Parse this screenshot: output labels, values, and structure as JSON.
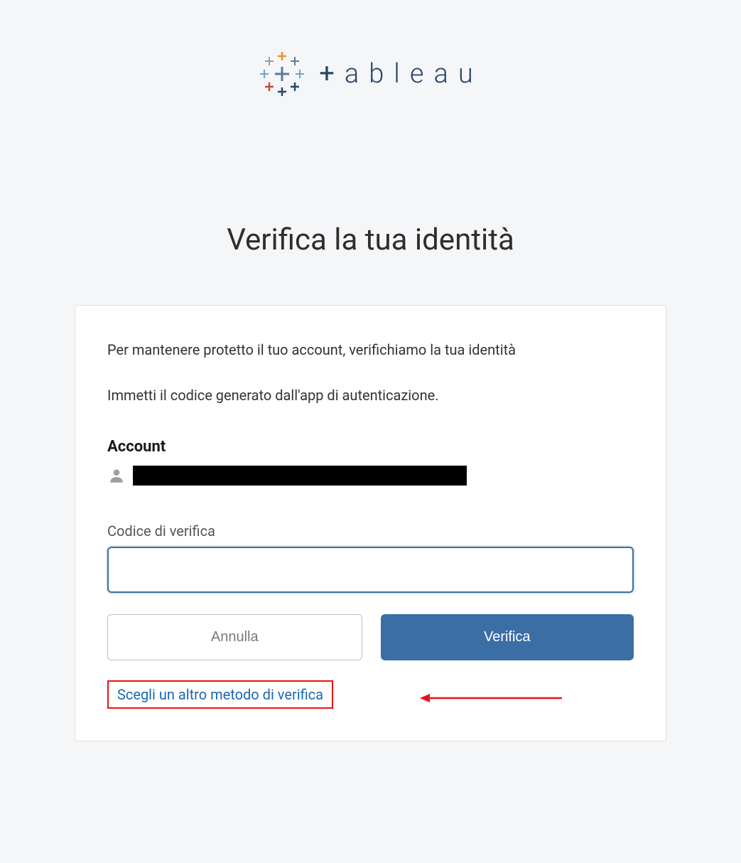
{
  "logo": {
    "wordmark_prefix": "+",
    "wordmark_rest": "ableau"
  },
  "page": {
    "heading": "Verifica la tua identità"
  },
  "card": {
    "description_1": "Per mantenere protetto il tuo account, verifichiamo la tua identità",
    "description_2": "Immetti il codice generato dall'app di autenticazione.",
    "account_label": "Account",
    "account_value": "",
    "code_label": "Codice di verifica",
    "code_value": "",
    "cancel_button": "Annulla",
    "verify_button": "Verifica",
    "alt_method_link": "Scegli un altro metodo di verifica"
  },
  "colors": {
    "accent": "#3b6ea5",
    "link": "#1a68b3",
    "annotation": "#e11"
  }
}
